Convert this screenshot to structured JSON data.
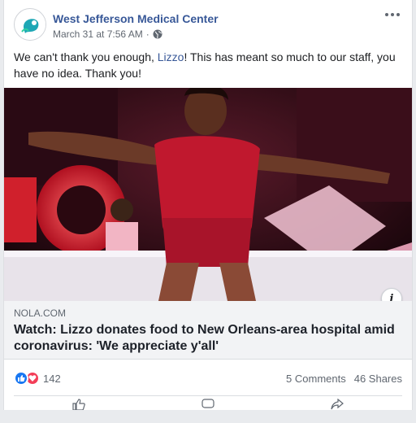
{
  "post": {
    "page_name": "West Jefferson Medical Center",
    "timestamp": "March 31 at 7:56 AM",
    "text_before": "We can't thank you enough, ",
    "mention": "Lizzo",
    "text_after": "! This has meant so much to our staff, you have no idea. Thank you!"
  },
  "link": {
    "domain": "NOLA.COM",
    "headline": "Watch: Lizzo donates food to New Orleans-area hospital amid coronavirus: 'We appreciate y'all'"
  },
  "stats": {
    "reaction_count": "142",
    "comments": "5 Comments",
    "shares": "46 Shares"
  },
  "icons": [
    "avatar-logo",
    "globe-icon",
    "more-options-icon",
    "info-icon",
    "like-reaction-icon",
    "love-reaction-icon",
    "like-action-icon",
    "comment-action-icon",
    "share-action-icon"
  ],
  "colors": {
    "brand_link": "#385898",
    "like": "#1877f2",
    "love": "#f33e58",
    "logo_teal": "#1ea7b5"
  }
}
